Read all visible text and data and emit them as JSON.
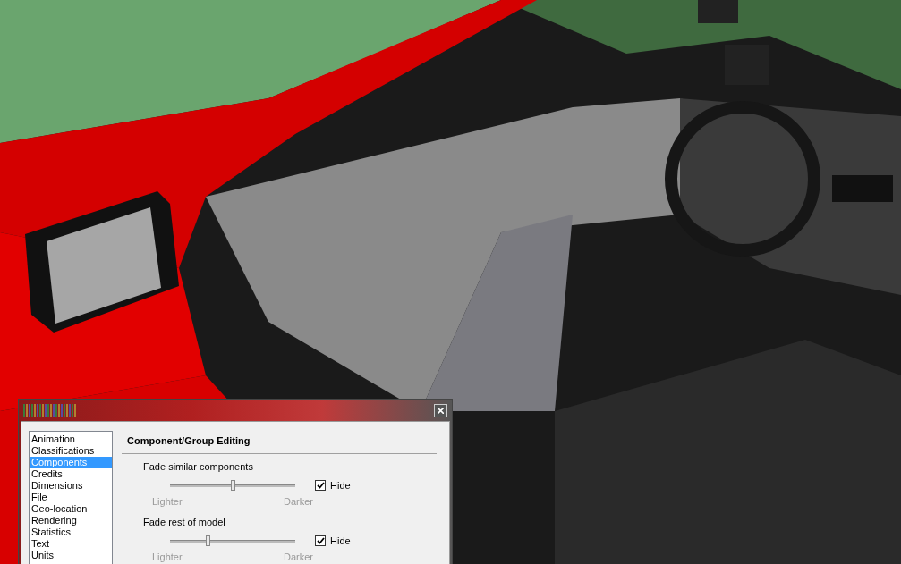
{
  "dialog": {
    "categories": [
      {
        "label": "Animation",
        "selected": false
      },
      {
        "label": "Classifications",
        "selected": false
      },
      {
        "label": "Components",
        "selected": true
      },
      {
        "label": "Credits",
        "selected": false
      },
      {
        "label": "Dimensions",
        "selected": false
      },
      {
        "label": "File",
        "selected": false
      },
      {
        "label": "Geo-location",
        "selected": false
      },
      {
        "label": "Rendering",
        "selected": false
      },
      {
        "label": "Statistics",
        "selected": false
      },
      {
        "label": "Text",
        "selected": false
      },
      {
        "label": "Units",
        "selected": false
      }
    ],
    "section_title": "Component/Group Editing",
    "settings": [
      {
        "label": "Fade similar components",
        "level": 0.51,
        "min_label": "Lighter",
        "max_label": "Darker",
        "hide": {
          "label": "Hide",
          "checked": true
        }
      },
      {
        "label": "Fade rest of model",
        "level": 0.31,
        "min_label": "Lighter",
        "max_label": "Darker",
        "hide": {
          "label": "Hide",
          "checked": true
        }
      }
    ]
  }
}
